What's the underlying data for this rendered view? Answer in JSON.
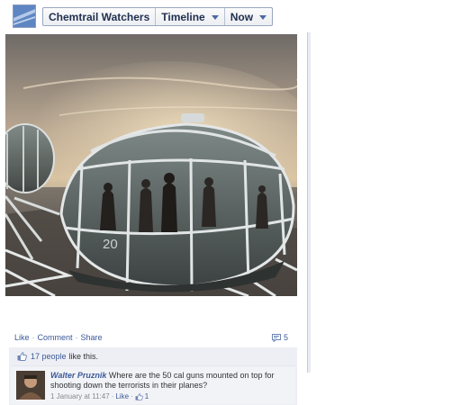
{
  "header": {
    "page_name": "Chemtrail Watchers",
    "view_label": "Timeline",
    "time_label": "Now"
  },
  "post": {
    "photo_caption_number": "20",
    "actions": {
      "like": "Like",
      "comment": "Comment",
      "share": "Share",
      "separator": "·"
    },
    "comment_count": "5"
  },
  "likes": {
    "count_text": "17 people",
    "suffix": "like this."
  },
  "comment": {
    "author": "Walter Pruznik",
    "text": "Where are the 50 cal guns mounted on top for shooting down the terrorists in their planes?",
    "timestamp": "1 January at 11:47",
    "like_label": "Like",
    "like_count": "1",
    "separator": "·"
  },
  "colors": {
    "link": "#3b5998",
    "feedback_bg": "#edeff4"
  }
}
